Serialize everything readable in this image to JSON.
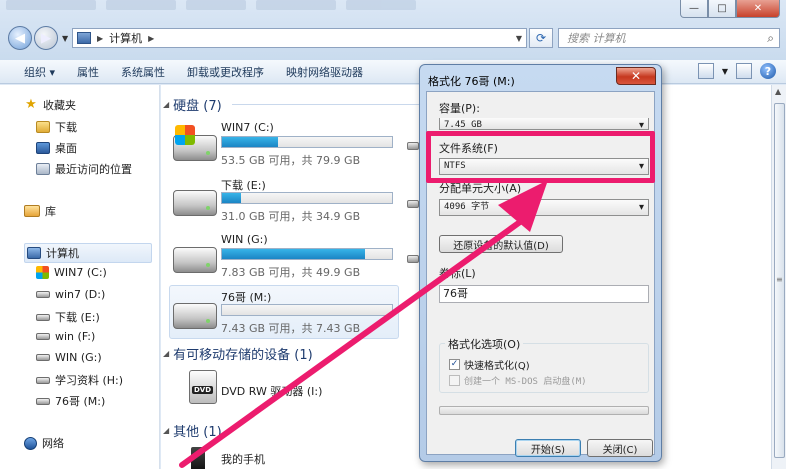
{
  "window": {
    "minimize": "—",
    "maximize": "□",
    "close": "✕"
  },
  "address": {
    "path": "计算机",
    "search_placeholder": "搜索 计算机"
  },
  "toolbar": {
    "organize": "组织 ▾",
    "properties": "属性",
    "system_properties": "系统属性",
    "uninstall": "卸载或更改程序",
    "map_drive": "映射网络驱动器"
  },
  "navpane": {
    "favorites": "收藏夹",
    "downloads": "下载",
    "desktop": "桌面",
    "recent": "最近访问的位置",
    "libraries": "库",
    "computer": "计算机",
    "drives": [
      "WIN7 (C:)",
      "win7 (D:)",
      "下载 (E:)",
      "win (F:)",
      "WIN (G:)",
      "学习资料 (H:)",
      "76哥 (M:)"
    ],
    "network": "网络"
  },
  "content": {
    "hdd_header": "硬盘 (7)",
    "removable_header": "有可移动存储的设备 (1)",
    "other_header": "其他 (1)",
    "drives": [
      {
        "name": "WIN7 (C:)",
        "free": "53.5 GB 可用，共 79.9 GB",
        "used_fraction": 0.33
      },
      {
        "name": "下载 (E:)",
        "free": "31.0 GB 可用，共 34.9 GB",
        "used_fraction": 0.11
      },
      {
        "name": "WIN (G:)",
        "free": "7.83 GB 可用，共 49.9 GB",
        "used_fraction": 0.84
      },
      {
        "name": "76哥 (M:)",
        "free": "7.43 GB 可用，共 7.43 GB",
        "used_fraction": 0.0
      }
    ],
    "dvd_name": "DVD RW 驱动器 (I:)",
    "dvd_badge": "DVD",
    "phone_name": "我的手机"
  },
  "dialog": {
    "title": "格式化 76哥 (M:)",
    "close": "✕",
    "capacity_label": "容量(P):",
    "capacity_value": "7.45 GB",
    "fs_label": "文件系统(F)",
    "fs_value": "NTFS",
    "alloc_label": "分配单元大小(A)",
    "alloc_value": "4096 字节",
    "restore_button": "还原设备的默认值(D)",
    "volume_label": "卷标(L)",
    "volume_value": "76哥",
    "options_label": "格式化选项(O)",
    "quick_format": "快速格式化(Q)",
    "msdos_disk": "创建一个 MS-DOS 启动盘(M)",
    "start_button": "开始(S)",
    "close_button": "关闭(C)"
  },
  "colors": {
    "highlight": "#ec1c6e",
    "drive_bar": "#26a0da"
  }
}
